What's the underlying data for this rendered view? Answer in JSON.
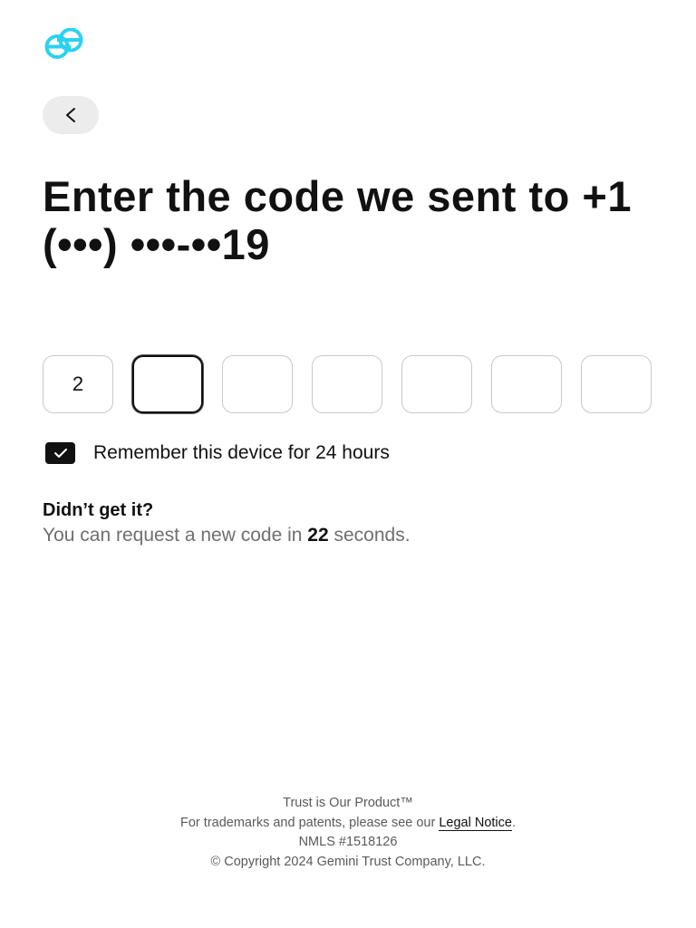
{
  "brand": {
    "logo_icon": "gemini-logo-icon",
    "accent_color": "#2bd1f2"
  },
  "nav": {
    "back_label": "<",
    "back_icon": "chevron-left-icon"
  },
  "main": {
    "heading": "Enter the code we sent to +1 (•••) •••-••19",
    "code_digits": [
      "2",
      "",
      "",
      "",
      "",
      "",
      ""
    ],
    "active_index": 1,
    "remember_checked": true,
    "remember_label": "Remember this device for 24 hours",
    "resend_title": "Didn’t get it?",
    "resend_prefix": "You can request a new code in ",
    "resend_seconds": "22",
    "resend_suffix": " seconds."
  },
  "footer": {
    "line1": "Trust is Our Product™",
    "line2_prefix": "For trademarks and patents, please see our ",
    "legal_link": "Legal Notice",
    "line2_suffix": ".",
    "nmls": "NMLS #1518126",
    "copyright": "© Copyright 2024 Gemini Trust Company, LLC."
  }
}
